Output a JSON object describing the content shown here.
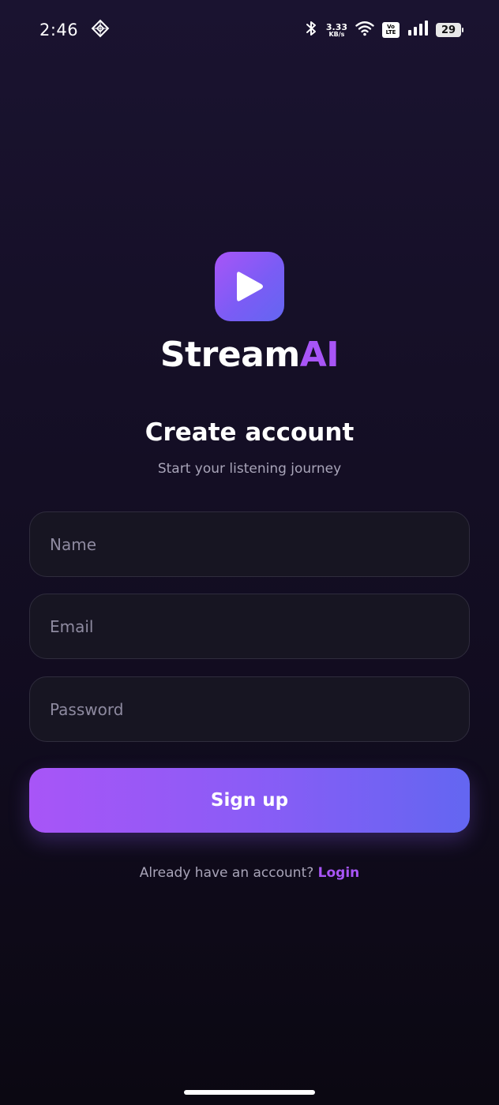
{
  "status_bar": {
    "time": "2:46",
    "net_speed_value": "3.33",
    "net_speed_unit": "KB/s",
    "volte_top": "Vo",
    "volte_bottom": "LTE",
    "battery_level": "29"
  },
  "brand": {
    "name_part1": "Stream",
    "name_part2": "AI",
    "accent_color": "#a855f7",
    "logo_icon": "play-icon"
  },
  "heading": "Create account",
  "subheading": "Start your listening journey",
  "form": {
    "name_placeholder": "Name",
    "email_placeholder": "Email",
    "password_placeholder": "Password",
    "submit_label": "Sign up"
  },
  "footer": {
    "prompt_text": "Already have an account?",
    "login_label": "Login"
  },
  "colors": {
    "gradient_start": "#a855f7",
    "gradient_end": "#6366f1",
    "background": "#150f26"
  }
}
